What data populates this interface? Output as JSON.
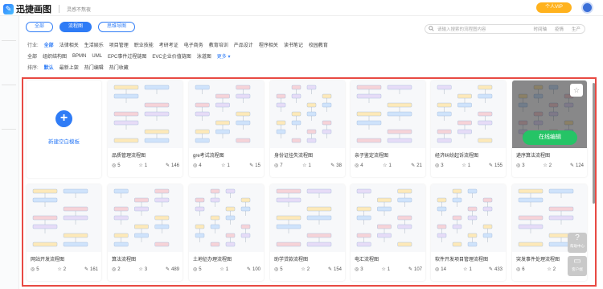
{
  "app": {
    "name": "迅捷画图",
    "slogan": "灵感不熬夜",
    "vip_label": "个人VIP"
  },
  "tabs": [
    {
      "label": "全部",
      "active": false
    },
    {
      "label": "流程图",
      "active": true
    },
    {
      "label": "思维导图",
      "active": false
    }
  ],
  "search": {
    "placeholder": "请输入搜索的流程图内容",
    "keywords": [
      "时间轴",
      "疫情",
      "生产"
    ]
  },
  "industry": {
    "label": "行业:",
    "items": [
      "全部",
      "法律相关",
      "生活娱乐",
      "项目管理",
      "职业技能",
      "考研考证",
      "电子商务",
      "教育培训",
      "产品设计",
      "程序相关",
      "读书笔记",
      "校园教育"
    ]
  },
  "type": {
    "items": [
      "全部",
      "组织结构图",
      "BPMN",
      "UML",
      "EPC事件过程链图",
      "EVC企业价值链图",
      "泳道图",
      "更多"
    ]
  },
  "sort": {
    "label": "排序:",
    "items": [
      "默认",
      "最新上架",
      "热门编辑",
      "热门收藏"
    ]
  },
  "blank_card": {
    "label": "新建空白模板"
  },
  "cards": [
    {
      "title": "品质管理流程图",
      "views": "5",
      "likes": "1",
      "edits": "146"
    },
    {
      "title": "gre考试流程图",
      "views": "4",
      "likes": "1",
      "edits": "15"
    },
    {
      "title": "身份证挂失流程图",
      "views": "7",
      "likes": "1",
      "edits": "38"
    },
    {
      "title": "亲子鉴定流程图",
      "views": "4",
      "likes": "1",
      "edits": "21"
    },
    {
      "title": "经济纠纷起诉流程图",
      "views": "3",
      "likes": "1",
      "edits": "155"
    },
    {
      "title": "递序算法流程图",
      "views": "3",
      "likes": "2",
      "edits": "124"
    },
    {
      "title": "网站开发流程图",
      "views": "5",
      "likes": "2",
      "edits": "161"
    },
    {
      "title": "算法流程图",
      "views": "2",
      "likes": "3",
      "edits": "489"
    },
    {
      "title": "土地征办理流程图",
      "views": "5",
      "likes": "1",
      "edits": "100"
    },
    {
      "title": "助学贷款流程图",
      "views": "5",
      "likes": "2",
      "edits": "154"
    },
    {
      "title": "电汇流程图",
      "views": "3",
      "likes": "1",
      "edits": "107"
    },
    {
      "title": "软件开发项目管理流程图",
      "views": "14",
      "likes": "1",
      "edits": "433"
    },
    {
      "title": "突发事件处理流程图",
      "views": "6",
      "likes": "2",
      "edits": ""
    }
  ],
  "hover": {
    "edit_label": "在线编辑",
    "fav_icon": "star-icon"
  },
  "float_buttons": [
    {
      "label": "帮助中心",
      "icon": "help-icon"
    },
    {
      "label": "客户端",
      "icon": "desktop-icon"
    }
  ],
  "colors": {
    "accent": "#2f7cf6",
    "frame": "#e84a43",
    "edit": "#25c466",
    "vip": "#ffb21d"
  }
}
